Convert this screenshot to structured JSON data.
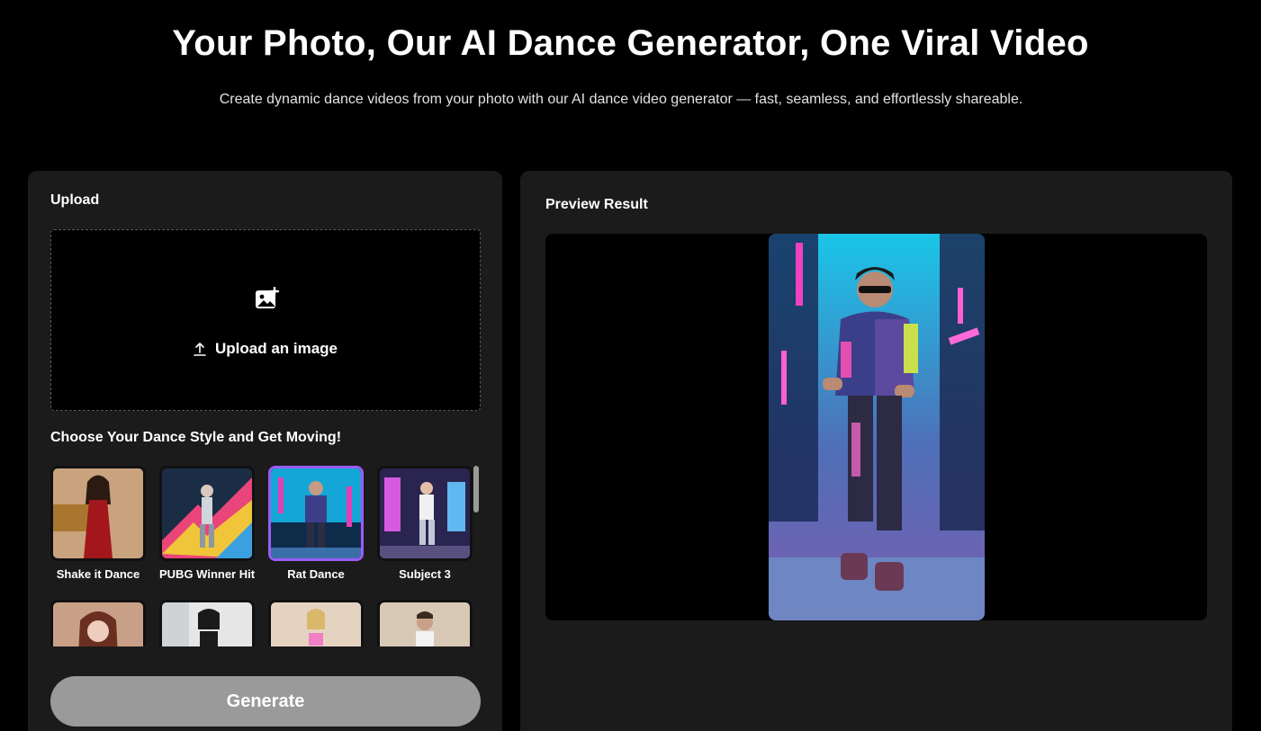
{
  "hero": {
    "title": "Your Photo, Our AI Dance Generator, One Viral Video",
    "subtitle": "Create dynamic dance videos from your photo with our AI dance video generator — fast, seamless, and effortlessly shareable."
  },
  "upload_panel": {
    "heading": "Upload",
    "upload_label": "Upload an image",
    "icons": {
      "photo": "add-photo-icon",
      "upload": "upload-arrow-icon"
    }
  },
  "dance_styles": {
    "heading": "Choose Your Dance Style and Get Moving!",
    "selected": "Rat Dance",
    "items": [
      {
        "label": "Shake it Dance"
      },
      {
        "label": "PUBG Winner Hit"
      },
      {
        "label": "Rat Dance"
      },
      {
        "label": "Subject 3"
      }
    ],
    "accent_color": "#9b5cf5"
  },
  "generate": {
    "label": "Generate",
    "color": "#9a9a9a"
  },
  "preview_panel": {
    "heading": "Preview Result"
  },
  "colors": {
    "background": "#000000",
    "panel": "#1b1b1b"
  }
}
